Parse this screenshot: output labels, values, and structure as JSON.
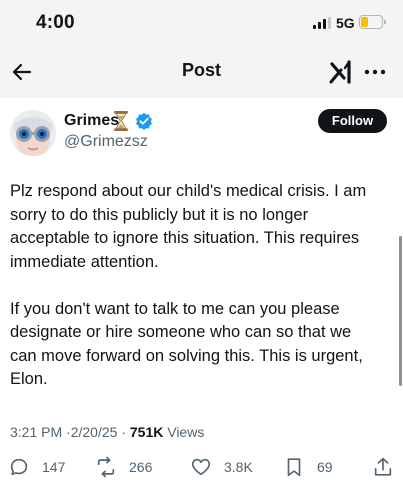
{
  "status_bar": {
    "time": "4:00",
    "network": "5G",
    "signal_icon": "signal-bars-icon",
    "battery_icon": "battery-icon",
    "battery_color": "#f2c200"
  },
  "header": {
    "title": "Post",
    "back_icon": "back-arrow-icon",
    "grok_icon": "grok-logo-icon",
    "more_icon": "more-options-icon"
  },
  "author": {
    "name": "Grimes",
    "name_emoji": "⌛",
    "verified_icon": "verified-badge-icon",
    "verified_color": "#1d9bf0",
    "handle": "@Grimezsz",
    "follow_label": "Follow"
  },
  "tweet": {
    "lines": [
      "Plz respond about our child's medical crisis.  I am",
      "sorry to do this publicly but it is no longer",
      "acceptable to ignore this situation.  This requires",
      "immediate attention.",
      "",
      "If you don't want to talk to me can you please",
      "designate or hire someone who can so that we",
      "can move forward on solving this.   This is urgent,",
      "Elon."
    ]
  },
  "meta": {
    "time": "3:21 PM",
    "separator": "·",
    "date": "2/20/25",
    "views_count": "751K",
    "views_label": "Views"
  },
  "actions": {
    "replies": "147",
    "reposts": "266",
    "likes": "3.8K",
    "bookmarks": "69"
  }
}
